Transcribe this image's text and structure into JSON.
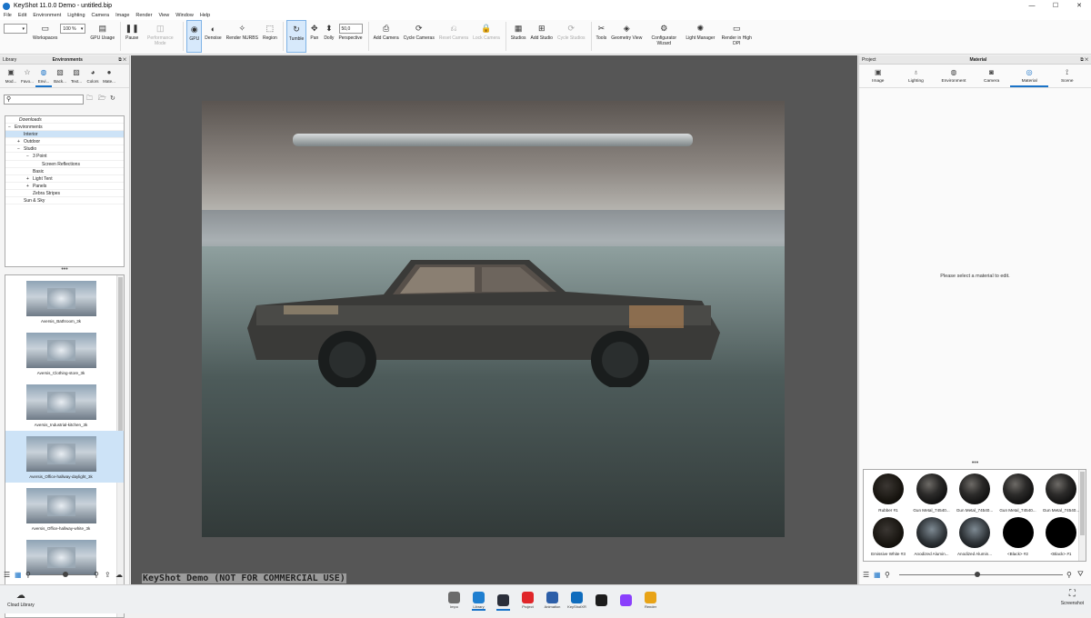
{
  "window": {
    "title": "KeyShot 11.0.0 Demo  - untitled.bip",
    "minimize": "—",
    "maximize": "☐",
    "close": "✕"
  },
  "menu": [
    "File",
    "Edit",
    "Environment",
    "Lighting",
    "Camera",
    "Image",
    "Render",
    "View",
    "Window",
    "Help"
  ],
  "toolbar": {
    "zoom_value": "100 %",
    "perspective_value": "50,0",
    "buttons": [
      {
        "label": "Workspaces",
        "icon": "workspaces-icon",
        "state": "normal"
      },
      {
        "label": "GPU Usage",
        "icon": "gpu-usage-icon",
        "state": "normal"
      },
      {
        "label": "Pause",
        "icon": "pause-icon",
        "state": "normal"
      },
      {
        "label": "Performance Mode",
        "icon": "performance-icon",
        "state": "disabled"
      },
      {
        "label": "GPU",
        "icon": "gpu-icon",
        "state": "active"
      },
      {
        "label": "Denoise",
        "icon": "denoise-icon",
        "state": "normal"
      },
      {
        "label": "Render NURBS",
        "icon": "nurbs-icon",
        "state": "normal"
      },
      {
        "label": "Region",
        "icon": "region-icon",
        "state": "normal"
      },
      {
        "label": "Tumble",
        "icon": "tumble-icon",
        "state": "active"
      },
      {
        "label": "Pan",
        "icon": "pan-icon",
        "state": "normal"
      },
      {
        "label": "Dolly",
        "icon": "dolly-icon",
        "state": "normal"
      },
      {
        "label": "Perspective",
        "icon": "perspective-icon",
        "state": "normal"
      },
      {
        "label": "Add Camera",
        "icon": "add-camera-icon",
        "state": "normal"
      },
      {
        "label": "Cycle Cameras",
        "icon": "cycle-cameras-icon",
        "state": "normal"
      },
      {
        "label": "Reset Camera",
        "icon": "reset-camera-icon",
        "state": "disabled"
      },
      {
        "label": "Lock Camera",
        "icon": "lock-camera-icon",
        "state": "disabled"
      },
      {
        "label": "Studios",
        "icon": "studios-icon",
        "state": "normal"
      },
      {
        "label": "Add Studio",
        "icon": "add-studio-icon",
        "state": "normal"
      },
      {
        "label": "Cycle Studios",
        "icon": "cycle-studios-icon",
        "state": "disabled"
      },
      {
        "label": "Tools",
        "icon": "tools-icon",
        "state": "normal"
      },
      {
        "label": "Geometry View",
        "icon": "geometry-view-icon",
        "state": "normal"
      },
      {
        "label": "Configurator Wizard",
        "icon": "configurator-icon",
        "state": "normal"
      },
      {
        "label": "Light Manager",
        "icon": "light-manager-icon",
        "state": "normal"
      },
      {
        "label": "Render in High DPI",
        "icon": "high-dpi-icon",
        "state": "normal"
      }
    ]
  },
  "library": {
    "header_left": "Library",
    "header_center": "Environments",
    "tabs": [
      {
        "label": "Mod...",
        "icon": "models-icon"
      },
      {
        "label": "Favo...",
        "icon": "favorites-icon"
      },
      {
        "label": "Envi...",
        "icon": "environments-icon"
      },
      {
        "label": "Back...",
        "icon": "backplates-icon"
      },
      {
        "label": "Text...",
        "icon": "textures-icon"
      },
      {
        "label": "Colors",
        "icon": "colors-icon"
      },
      {
        "label": "Mate...",
        "icon": "materials-icon"
      }
    ],
    "search_placeholder": "",
    "tree": [
      {
        "label": "Downloads",
        "indent": 1,
        "italic": true,
        "toggle": ""
      },
      {
        "label": "Environments",
        "indent": 0,
        "italic": false,
        "toggle": "−"
      },
      {
        "label": "Interior",
        "indent": 2,
        "italic": false,
        "toggle": "",
        "selected": true
      },
      {
        "label": "Outdoor",
        "indent": 2,
        "italic": false,
        "toggle": "+"
      },
      {
        "label": "Studio",
        "indent": 2,
        "italic": false,
        "toggle": "−"
      },
      {
        "label": "3 Point",
        "indent": 4,
        "italic": false,
        "toggle": "−"
      },
      {
        "label": "Screen Reflections",
        "indent": 6,
        "italic": false,
        "toggle": ""
      },
      {
        "label": "Basic",
        "indent": 4,
        "italic": false,
        "toggle": ""
      },
      {
        "label": "Light Tent",
        "indent": 4,
        "italic": false,
        "toggle": "+"
      },
      {
        "label": "Panels",
        "indent": 4,
        "italic": false,
        "toggle": "+"
      },
      {
        "label": "Zebra Stripes",
        "indent": 4,
        "italic": false,
        "toggle": ""
      },
      {
        "label": "Sun & Sky",
        "indent": 2,
        "italic": false,
        "toggle": ""
      }
    ],
    "thumbnails": [
      {
        "caption": "Aversis_Bathroom_3k",
        "selected": false
      },
      {
        "caption": "Aversis_Clothing-store_3k",
        "selected": false
      },
      {
        "caption": "Aversis_Industrial-kitchen_3k",
        "selected": false
      },
      {
        "caption": "Aversis_Office-hallway-daylight_3k",
        "selected": true
      },
      {
        "caption": "Aversis_Office-hallway-white_3k",
        "selected": false
      },
      {
        "caption": "",
        "selected": false
      }
    ],
    "dots": "•••"
  },
  "viewport": {
    "watermark": "KeyShot Demo (NOT FOR COMMERCIAL USE)"
  },
  "project": {
    "header_left": "Project",
    "header_center": "Material",
    "tabs": [
      {
        "label": "Image",
        "icon": "image-icon"
      },
      {
        "label": "Lighting",
        "icon": "lighting-icon"
      },
      {
        "label": "Environment",
        "icon": "environment-icon"
      },
      {
        "label": "Camera",
        "icon": "camera-icon"
      },
      {
        "label": "Material",
        "icon": "material-icon",
        "active": true
      },
      {
        "label": "Scene",
        "icon": "scene-icon"
      }
    ],
    "hint": "Please select a material to edit.",
    "dots": "•••",
    "materials": [
      {
        "label": "Rubber #1",
        "kind": "rubber"
      },
      {
        "label": "Gun Metal_74540...",
        "kind": "metal"
      },
      {
        "label": "Gun Metal_74540...",
        "kind": "metal"
      },
      {
        "label": "Gun Metal_74540...",
        "kind": "metal"
      },
      {
        "label": "Gun Metal_74540...",
        "kind": "metal"
      },
      {
        "label": "Emissive White #3",
        "kind": "rubber"
      },
      {
        "label": "Anodized Alumin...",
        "kind": "anod"
      },
      {
        "label": "Anodized Alumin...",
        "kind": "anod"
      },
      {
        "label": "<Black> #2",
        "kind": "black"
      },
      {
        "label": "<Black> #1",
        "kind": "black"
      }
    ]
  },
  "bottom": {
    "cloud_library": "Cloud Library",
    "screenshot": "Screenshot",
    "taskbar": [
      {
        "label": "Impo",
        "color": "#6b6b6b"
      },
      {
        "label": "Library",
        "color": "#1f7fd0",
        "on": true
      },
      {
        "label": "",
        "color": "#2b2f3a",
        "on": true
      },
      {
        "label": "Project",
        "color": "#e0262a"
      },
      {
        "label": "Animation",
        "color": "#2c5ea8"
      },
      {
        "label": "KeyShotXR",
        "color": "#0f6cbd"
      },
      {
        "label": "",
        "color": "#1c1c1c"
      },
      {
        "label": "",
        "color": "#8a3ffc"
      },
      {
        "label": "Render",
        "color": "#e8a317"
      }
    ]
  }
}
